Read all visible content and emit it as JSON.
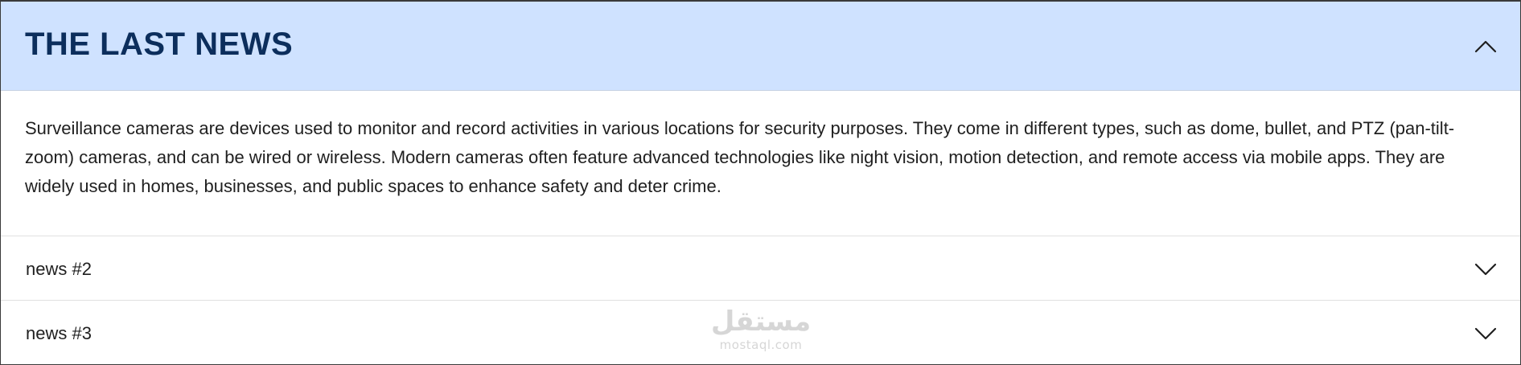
{
  "accordion": {
    "title": "THE LAST NEWS",
    "header_background": "#cfe2ff",
    "title_color": "#0c2e5c",
    "expanded_icon": "chevron-up-icon",
    "body_text": "Surveillance cameras are devices used to monitor and record activities in various locations for security purposes. They come in different types, such as dome, bullet, and PTZ (pan-tilt-zoom) cameras, and can be wired or wireless. Modern cameras often feature advanced technologies like night vision, motion detection, and remote access via mobile apps. They are widely used in homes, businesses, and public spaces to enhance safety and deter crime.",
    "items": [
      {
        "label": "news #2",
        "icon": "chevron-down-icon"
      },
      {
        "label": "news #3",
        "icon": "chevron-down-icon"
      }
    ]
  },
  "watermark": {
    "logo": "مستقل",
    "text": "mostaql.com"
  }
}
